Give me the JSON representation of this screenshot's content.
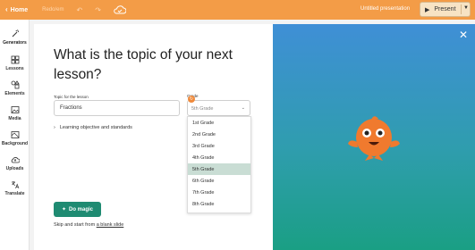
{
  "topbar": {
    "home_label": "Home",
    "redo_label": "Redo/em",
    "presentation_title": "Untitled presentation",
    "present_label": "Present"
  },
  "sidebar": {
    "items": [
      {
        "label": "Generators"
      },
      {
        "label": "Lessons"
      },
      {
        "label": "Elements"
      },
      {
        "label": "Media"
      },
      {
        "label": "Background"
      },
      {
        "label": "Uploads"
      },
      {
        "label": "Translate"
      }
    ]
  },
  "main": {
    "heading": "What is the topic of your next lesson?",
    "topic_label": "Topic for the lesson",
    "topic_value": "Fractions",
    "grade_label": "Grade",
    "grade_selected": "5th Grade",
    "objectives_label": "Learning objective and standards",
    "magic_button": "Do magic",
    "skip_text": "Skip and start from",
    "skip_link": "a blank slide"
  },
  "dropdown": {
    "options": [
      "1st Grade",
      "2nd Grade",
      "3rd Grade",
      "4th Grade",
      "5th Grade",
      "6th Grade",
      "7th Grade",
      "8th Grade"
    ],
    "selected_index": 4
  },
  "colors": {
    "topbar": "#f39c47",
    "magic_button": "#1f8b72",
    "selected_option": "#c9ddd4",
    "hero_top": "#3f8fd6",
    "hero_bottom": "#1a9f84"
  }
}
